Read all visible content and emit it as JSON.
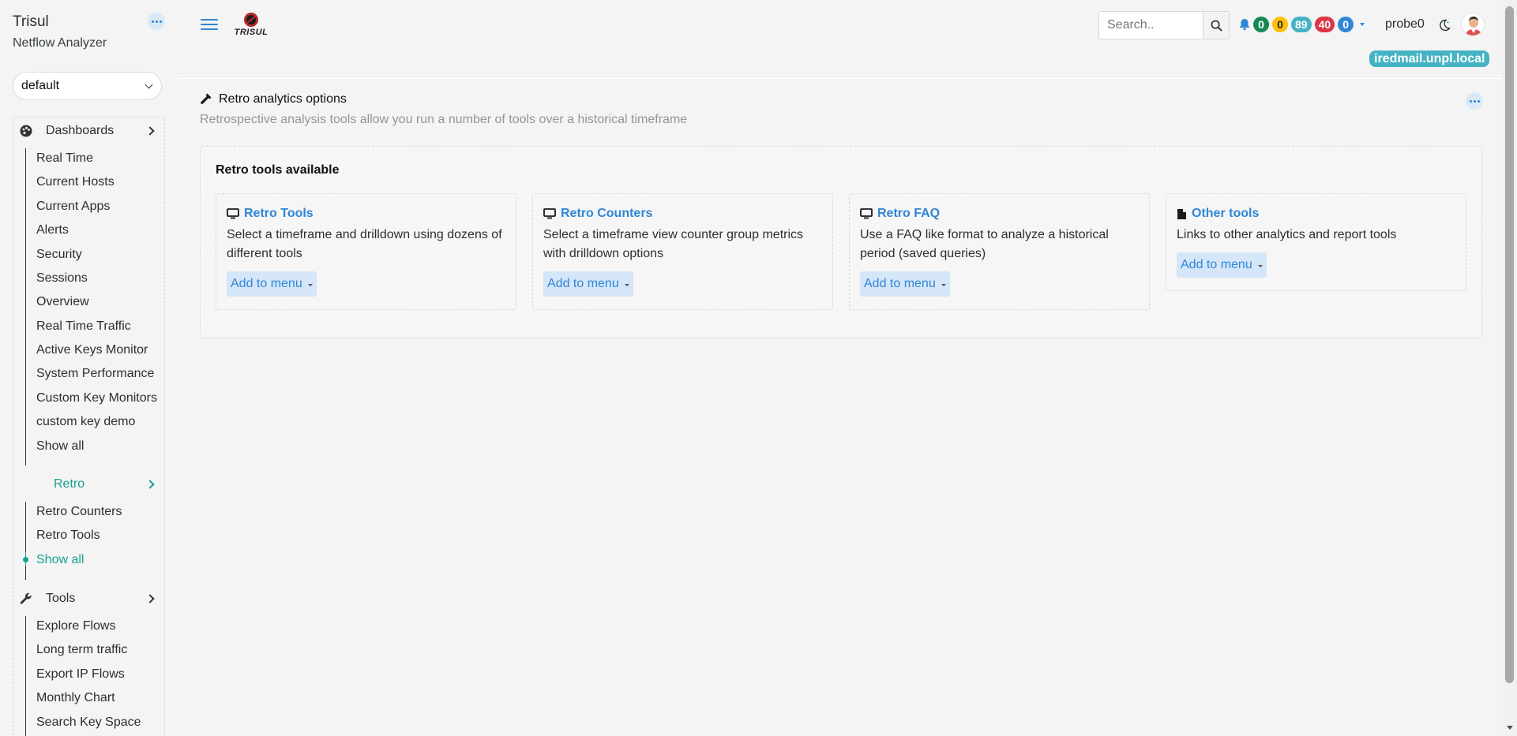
{
  "brand": {
    "title": "Trisul",
    "subtitle": "Netflow Analyzer",
    "logo_text": "TRISUL"
  },
  "workspace": {
    "selected": "default"
  },
  "sidebar": {
    "groups": [
      {
        "label": "Dashboards",
        "icon": "palette-icon",
        "items": [
          "Real Time",
          "Current Hosts",
          "Current Apps",
          "Alerts",
          "Security",
          "Sessions",
          "Overview",
          "Real Time Traffic",
          "Active Keys Monitor",
          "System Performance",
          "Custom Key Monitors",
          "custom key demo",
          "Show all"
        ]
      },
      {
        "label": "Retro",
        "items": [
          "Retro Counters",
          "Retro Tools",
          "Show all"
        ],
        "active_item": "Show all"
      },
      {
        "label": "Tools",
        "icon": "wrench-icon",
        "items": [
          "Explore Flows",
          "Long term traffic",
          "Export IP Flows",
          "Monthly Chart",
          "Search Key Space"
        ]
      }
    ]
  },
  "topbar": {
    "search_placeholder": "Search..",
    "badges": [
      {
        "value": "0",
        "bg": "#198754",
        "fg": "#ffffff"
      },
      {
        "value": "0",
        "bg": "#ffc107",
        "fg": "#212529"
      },
      {
        "value": "89",
        "bg": "#45b3c4",
        "fg": "#ffffff"
      },
      {
        "value": "40",
        "bg": "#dc3545",
        "fg": "#ffffff"
      },
      {
        "value": "0",
        "bg": "#2f86d6",
        "fg": "#ffffff"
      }
    ],
    "probe": "probe0",
    "host": "iredmail.unpl.local"
  },
  "page": {
    "title": "Retro analytics options",
    "description": "Retrospective analysis tools allow you run a number of tools over a historical timeframe"
  },
  "panel": {
    "title": "Retro tools available",
    "cards": [
      {
        "icon": "monitor-icon",
        "title": "Retro Tools",
        "desc": "Select a timeframe and drilldown using dozens of different tools",
        "button": "Add to menu"
      },
      {
        "icon": "monitor-icon",
        "title": "Retro Counters",
        "desc": "Select a timeframe view counter group metrics with drilldown options",
        "button": "Add to menu"
      },
      {
        "icon": "monitor-icon",
        "title": "Retro FAQ",
        "desc": "Use a FAQ like format to analyze a historical period (saved queries)",
        "button": "Add to menu"
      },
      {
        "icon": "file-icon",
        "title": "Other tools",
        "desc": "Links to other analytics and report tools",
        "button": "Add to menu"
      }
    ]
  },
  "colors": {
    "accent": "#2f86d6",
    "teal": "#18a191",
    "background": "#f3f4f3"
  }
}
